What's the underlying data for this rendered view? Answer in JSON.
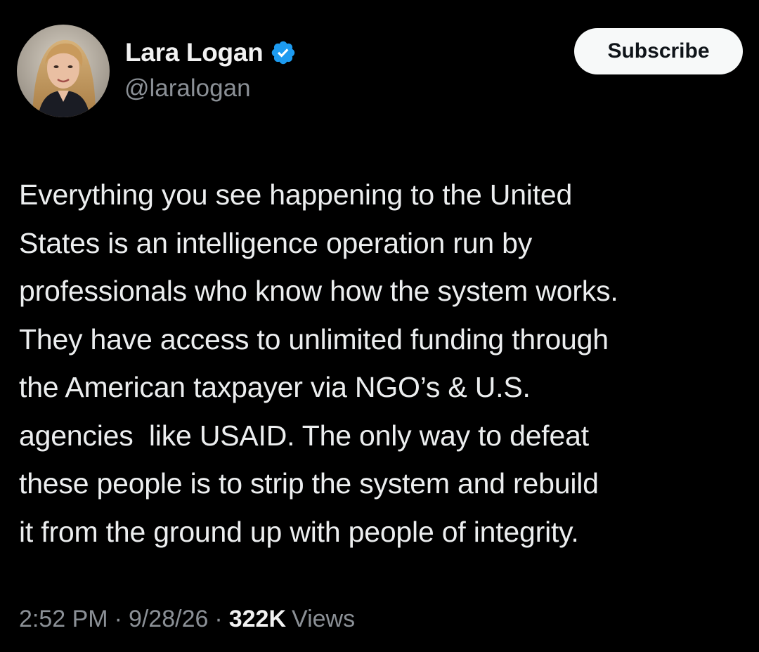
{
  "user": {
    "display_name": "Lara Logan",
    "handle": "@laralogan",
    "verified_icon": "verified-badge-icon",
    "avatar_icon": "profile-avatar"
  },
  "actions": {
    "subscribe_label": "Subscribe"
  },
  "tweet": {
    "lines": [
      "Everything you see happening to the United",
      "States is an intelligence operation run by",
      "professionals who know how the system works.",
      "They have access to unlimited funding through",
      "the American taxpayer via NGO’s & U.S.",
      "agencies  like USAID. The only way to defeat",
      "these people is to strip the system and rebuild",
      "it from the ground up with people of integrity."
    ]
  },
  "meta": {
    "time": "2:52 PM",
    "separator": "·",
    "date": "9/28/26",
    "views_count": "322K",
    "views_label": "Views"
  },
  "colors": {
    "background": "#000000",
    "text_primary": "#e7e9ea",
    "text_secondary": "#8b9096",
    "verified_blue": "#1d9bf0",
    "button_bg": "#f7f9f9"
  }
}
